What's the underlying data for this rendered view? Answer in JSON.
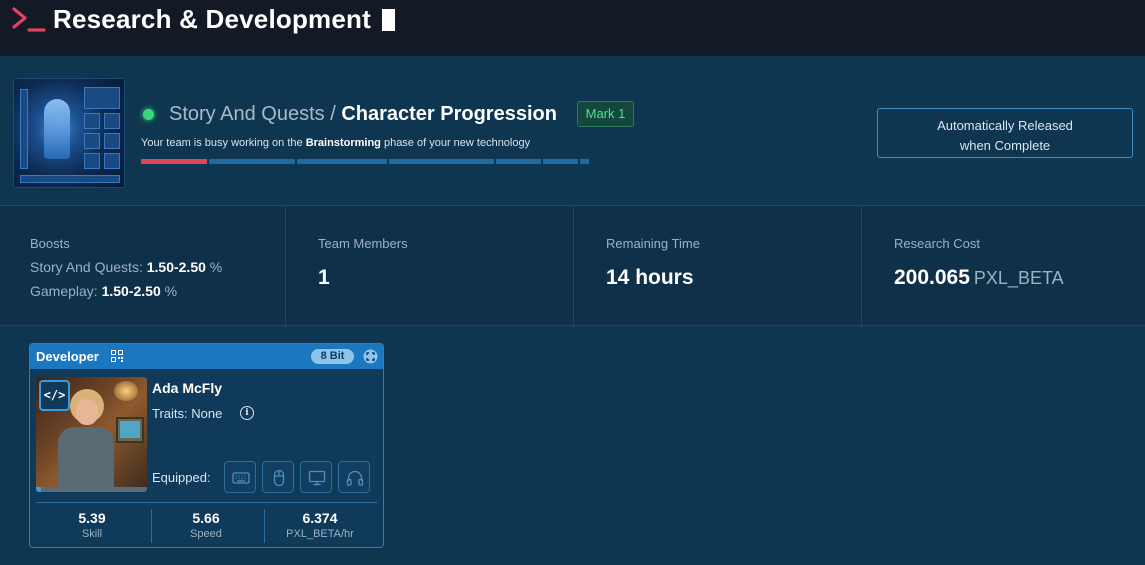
{
  "header": {
    "title": "Research & Development",
    "icon": "terminal-prompt-icon"
  },
  "project": {
    "category": "Story And Quests /",
    "name": "Character Progression",
    "mark": "Mark 1",
    "status_color": "#3ad77a",
    "phase_prefix": "Your team is busy working on the",
    "phase_name": "Brainstorming",
    "phase_suffix": "phase of your new technology",
    "progress_active_color": "#e0445d",
    "release_line1": "Automatically Released",
    "release_line2": "when Complete"
  },
  "stats": {
    "boosts": {
      "label": "Boosts",
      "items": [
        {
          "name": "Story And Quests:",
          "value": "1.50-2.50",
          "unit": "%"
        },
        {
          "name": "Gameplay:",
          "value": "1.50-2.50",
          "unit": "%"
        }
      ]
    },
    "team": {
      "label": "Team Members",
      "value": "1"
    },
    "time": {
      "label": "Remaining Time",
      "value": "14 hours"
    },
    "cost": {
      "label": "Research Cost",
      "value": "200.065",
      "unit": "PXL_BETA"
    }
  },
  "developer": {
    "role": "Developer",
    "tier": "8 Bit",
    "badge": "</>",
    "name": "Ada McFly",
    "traits": "Traits: None",
    "equipped_label": "Equipped:",
    "slots": [
      "keyboard-icon",
      "mouse-icon",
      "monitor-icon",
      "headphones-icon"
    ],
    "metrics": [
      {
        "value": "5.39",
        "label": "Skill"
      },
      {
        "value": "5.66",
        "label": "Speed"
      },
      {
        "value": "6.374",
        "label": "PXL_BETA/hr"
      }
    ]
  }
}
